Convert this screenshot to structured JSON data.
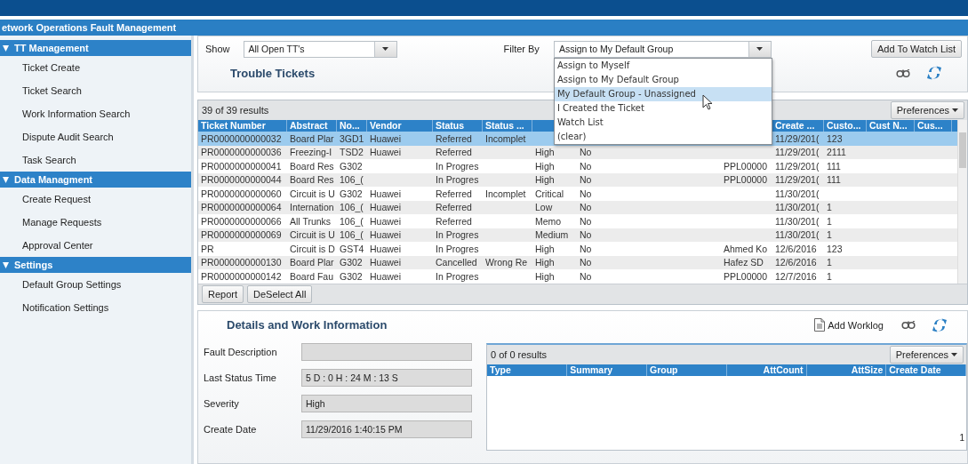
{
  "app": {
    "title": "etwork Operations Fault Management"
  },
  "sidebar": {
    "sections": [
      {
        "title": "TT Management",
        "expanded": true,
        "items": [
          "Ticket Create",
          "Ticket Search",
          "Work Information Search",
          "Dispute Audit Search",
          "Task Search"
        ]
      },
      {
        "title": "Data Managment",
        "expanded": true,
        "items": [
          "Create Request",
          "Manage Requests",
          "Approval Center"
        ]
      },
      {
        "title": "Settings",
        "expanded": true,
        "items": [
          "Default Group Settings",
          "Notification Settings"
        ]
      }
    ]
  },
  "filters": {
    "show": {
      "label": "Show",
      "value": "All Open TT's"
    },
    "filter_by": {
      "label": "Filter By",
      "value": "Assign to My Default Group",
      "expanded": true,
      "options": [
        {
          "label": "Assign to Myself",
          "highlighted": false
        },
        {
          "label": "Assign to My Default Group",
          "highlighted": false
        },
        {
          "label": "My Default Group - Unassigned",
          "highlighted": true
        },
        {
          "label": "I Created the Ticket",
          "highlighted": false
        },
        {
          "label": "Watch List",
          "highlighted": false
        },
        {
          "label": "(clear)",
          "highlighted": false
        }
      ]
    },
    "watch_button": "Add To Watch List"
  },
  "tickets": {
    "title": "Trouble Tickets",
    "count": "39 of 39 results",
    "preferences": "Preferences",
    "columns": [
      "Ticket Number",
      "Abstract",
      "No...",
      "Vendor",
      "Status",
      "Status ...",
      null,
      null,
      null,
      "Create ...",
      "Custo...",
      "Cust N...",
      "Cus..."
    ],
    "rows": [
      {
        "selected": true,
        "cells": [
          "PR0000000000032",
          "Board Plar",
          "3GD1",
          "Huawei",
          "Referred",
          "Incomplet",
          null,
          null,
          null,
          "11/29/201(",
          "123",
          null,
          null
        ]
      },
      {
        "selected": false,
        "cells": [
          "PR0000000000036",
          "Freezing-I",
          "TSD2",
          "Huawei",
          "Referred",
          null,
          "High",
          "No",
          null,
          "11/29/201(",
          "2111",
          null,
          null
        ]
      },
      {
        "selected": false,
        "cells": [
          "PR0000000000041",
          "Board Res",
          "G302",
          null,
          "In Progres",
          null,
          "High",
          "No",
          "PPL00000",
          "11/29/201(",
          "111",
          null,
          null
        ]
      },
      {
        "selected": false,
        "cells": [
          "PR0000000000044",
          "Board Res",
          "106_(",
          null,
          "In Progres",
          null,
          "High",
          "No",
          "PPL00000",
          "11/29/201(",
          "111",
          null,
          null
        ]
      },
      {
        "selected": false,
        "cells": [
          "PR0000000000060",
          "Circuit is U",
          "G302",
          "Huawei",
          "Referred",
          "Incomplet",
          "Critical",
          "No",
          null,
          "11/30/201(",
          null,
          null,
          null
        ]
      },
      {
        "selected": false,
        "cells": [
          "PR0000000000064",
          "Internation",
          "106_(",
          "Huawei",
          "Referred",
          null,
          "Low",
          "No",
          null,
          "11/30/201(",
          "1",
          null,
          null
        ]
      },
      {
        "selected": false,
        "cells": [
          "PR0000000000066",
          "All Trunks",
          "106_(",
          "Huawei",
          "Referred",
          null,
          "Memo",
          "No",
          null,
          "11/30/201(",
          "1",
          null,
          null
        ]
      },
      {
        "selected": false,
        "cells": [
          "PR0000000000069",
          "Circuit is U",
          "106_(",
          "Huawei",
          "In Progres",
          null,
          "Medium",
          "No",
          null,
          "11/30/201(",
          "1",
          null,
          null
        ]
      },
      {
        "selected": false,
        "cells": [
          "PR",
          "Circuit is D",
          "GST4",
          "Huawei",
          "In Progres",
          null,
          "High",
          "No",
          "Ahmed Ko",
          "12/6/2016",
          "123",
          null,
          null
        ]
      },
      {
        "selected": false,
        "cells": [
          "PR0000000000130",
          "Board Plar",
          "G302",
          "Huawei",
          "Cancelled",
          "Wrong Re",
          "High",
          "No",
          "Hafez SD",
          "12/6/2016",
          "1",
          null,
          null
        ]
      },
      {
        "selected": false,
        "cells": [
          "PR0000000000142",
          "Board Fau",
          "G302",
          "Huawei",
          "In Progres",
          null,
          "High",
          "No",
          "PPL00000",
          "12/7/2016",
          "1",
          null,
          null
        ]
      }
    ],
    "buttons": [
      "Report",
      "DeSelect All"
    ]
  },
  "details": {
    "title": "Details and Work Information",
    "add_worklog": "Add Worklog",
    "fields": [
      {
        "label": "Fault Description"
      },
      {
        "label": "Last Status Time",
        "value": "5 D : 0 H : 24 M : 13 S"
      },
      {
        "label": "Severity",
        "value": "High"
      },
      {
        "label": "Create Date",
        "value": "11/29/2016 1:40:15 PM"
      }
    ],
    "worklog": {
      "count": "0 of 0 results",
      "preferences": "Preferences",
      "columns": [
        "Type",
        "Summary",
        "Group",
        "AttCount",
        "AttSize",
        "Create Date"
      ],
      "page": "1"
    }
  }
}
